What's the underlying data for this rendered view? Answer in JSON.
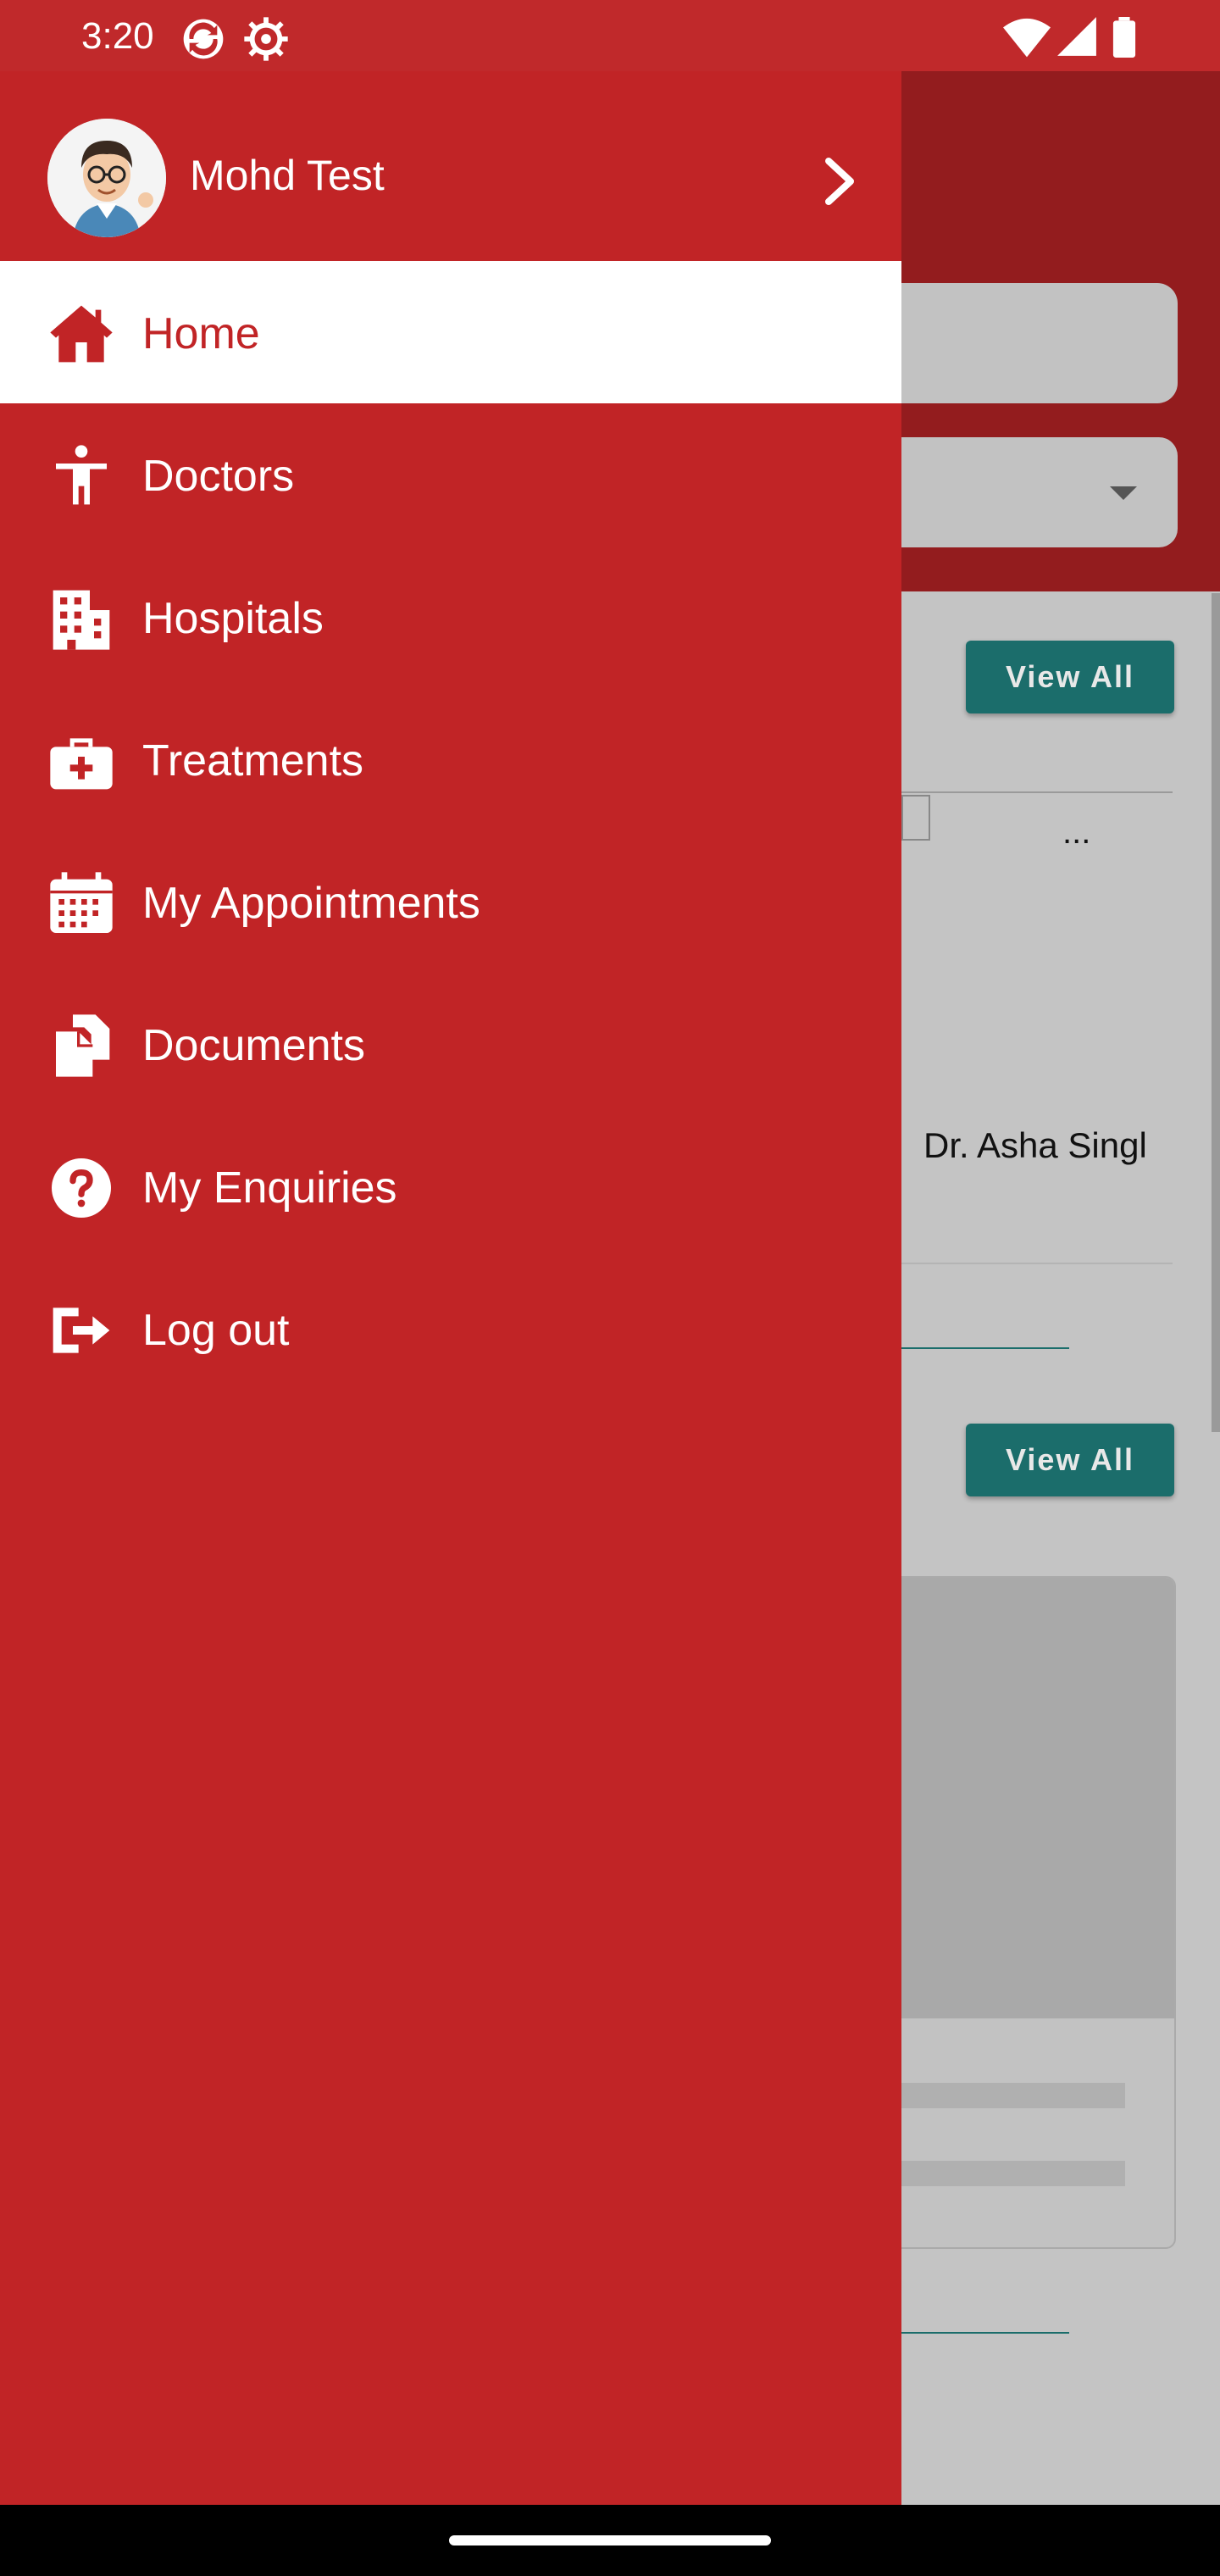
{
  "status_bar": {
    "time": "3:20",
    "icons": [
      "sync-icon",
      "settings-icon",
      "wifi-icon",
      "signal-icon",
      "battery-icon"
    ]
  },
  "background": {
    "view_all_label_1": "View All",
    "view_all_label_2": "View All",
    "ellipsis": "...",
    "doctor_name_partial": "Dr. Asha Singl"
  },
  "drawer": {
    "user_name": "Mohd Test",
    "items": [
      {
        "label": "Home",
        "icon": "home-icon",
        "active": true
      },
      {
        "label": "Doctors",
        "icon": "person-icon",
        "active": false
      },
      {
        "label": "Hospitals",
        "icon": "building-icon",
        "active": false
      },
      {
        "label": "Treatments",
        "icon": "medical-kit-icon",
        "active": false
      },
      {
        "label": "My Appointments",
        "icon": "calendar-icon",
        "active": false
      },
      {
        "label": "Documents",
        "icon": "documents-icon",
        "active": false
      },
      {
        "label": "My Enquiries",
        "icon": "help-icon",
        "active": false
      },
      {
        "label": "Log out",
        "icon": "logout-icon",
        "active": false
      }
    ]
  },
  "colors": {
    "primary": "#c12426",
    "teal": "#1b6d6b"
  }
}
